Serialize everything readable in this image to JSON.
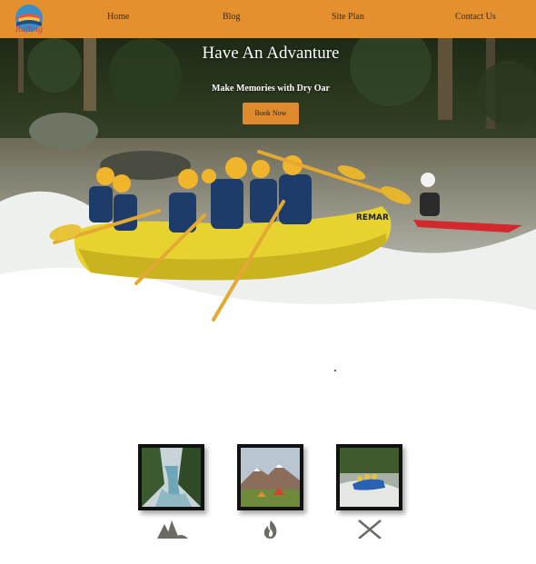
{
  "nav": {
    "logo_alt": "Rafting",
    "links": [
      "Home",
      "Blog",
      "Site Plan",
      "Contact Us"
    ]
  },
  "hero": {
    "title": "Have An Advanture",
    "subtitle": "Make Memories with Dry Oar",
    "button_label": "Book Now",
    "raft_text": "REMAR"
  },
  "cards": [
    {
      "image": "river-canyon"
    },
    {
      "image": "mountain-campsite"
    },
    {
      "image": "rafting-group"
    }
  ],
  "features": [
    {
      "icon": "trees-icon"
    },
    {
      "icon": "campfire-icon"
    },
    {
      "icon": "crossed-oars-icon"
    }
  ],
  "colors": {
    "nav_bg": "#e5902f",
    "button_bg": "#e08a2e",
    "icon": "#6b6b63"
  }
}
